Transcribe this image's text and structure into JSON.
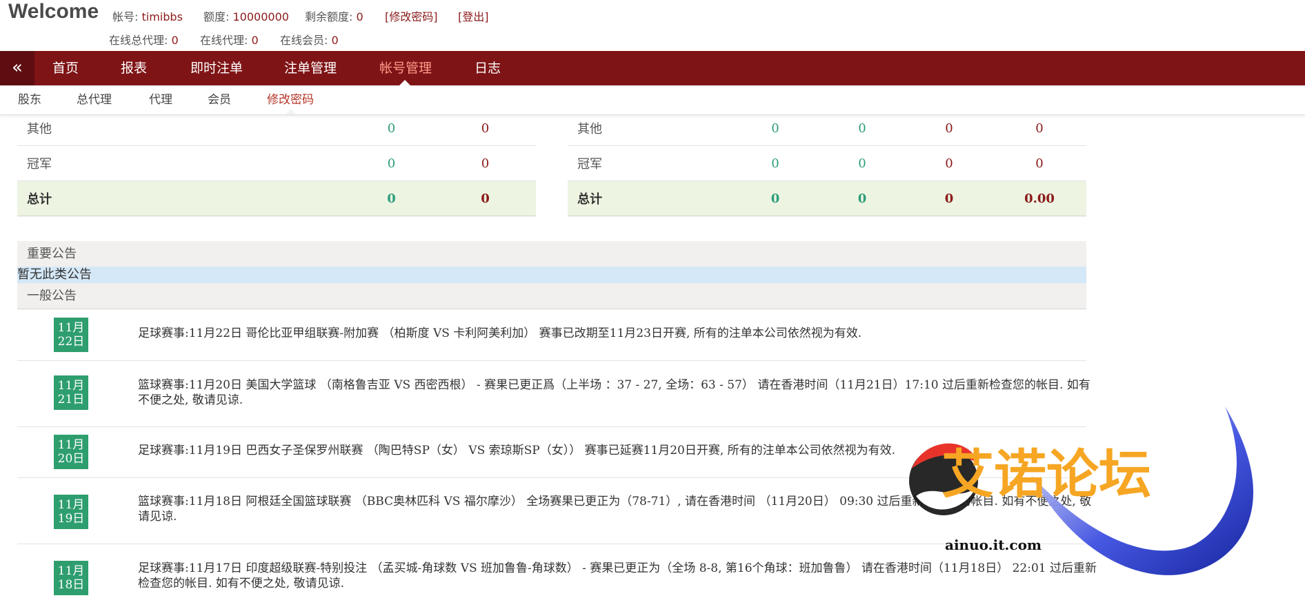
{
  "header": {
    "welcome": "Welcome",
    "account_label": "帐号:",
    "account_value": "timibbs",
    "credit_label": "额度:",
    "credit_value": "10000000",
    "remaining_label": "剩余额度:",
    "remaining_value": "0",
    "change_password": "[修改密码]",
    "logout": "[登出]",
    "online_gen_agents_label": "在线总代理:",
    "online_gen_agents_value": "0",
    "online_agents_label": "在线代理:",
    "online_agents_value": "0",
    "online_members_label": "在线会员:",
    "online_members_value": "0"
  },
  "nav": {
    "collapse_icon": "«",
    "items": [
      "首页",
      "报表",
      "即时注单",
      "注单管理",
      "帐号管理",
      "日志"
    ],
    "active": "帐号管理"
  },
  "subnav": {
    "items": [
      "股东",
      "总代理",
      "代理",
      "会员",
      "修改密码"
    ],
    "active": "修改密码"
  },
  "summary_left": [
    {
      "label": "其他",
      "a": "0",
      "b": "0"
    },
    {
      "label": "冠军",
      "a": "0",
      "b": "0"
    },
    {
      "label": "总计",
      "a": "0",
      "b": "0"
    }
  ],
  "summary_right": [
    {
      "label": "其他",
      "a": "0",
      "b": "0",
      "c": "0",
      "d": "0"
    },
    {
      "label": "冠军",
      "a": "0",
      "b": "0",
      "c": "0",
      "d": "0"
    },
    {
      "label": "总计",
      "a": "0",
      "b": "0",
      "c": "0",
      "d": "0.00"
    }
  ],
  "announcements": {
    "important_title": "重要公告",
    "important_empty": "暂无此类公告",
    "general_title": "一般公告",
    "items": [
      {
        "month": "11月",
        "day": "22日",
        "text": "足球赛事:11月22日 哥伦比亚甲组联赛-附加赛 （柏斯度 VS 卡利阿美利加） 赛事已改期至11月23日开赛, 所有的注单本公司依然视为有效."
      },
      {
        "month": "11月",
        "day": "21日",
        "text": "篮球赛事:11月20日 美国大学篮球 （南格鲁吉亚 VS 西密西根） - 赛果已更正爲（上半场 ：37 - 27, 全场：63 - 57） 请在香港时间（11月21日）17:10 过后重新检查您的帐目. 如有不便之处, 敬请见谅."
      },
      {
        "month": "11月",
        "day": "20日",
        "text": "足球赛事:11月19日 巴西女子圣保罗州联赛 （陶巴特SP（女） VS 索琼斯SP（女）） 赛事已延赛11月20日开赛, 所有的注单本公司依然视为有效."
      },
      {
        "month": "11月",
        "day": "19日",
        "text": "篮球赛事:11月18日 阿根廷全国篮球联赛 （BBC奥林匹科 VS 福尔摩沙） 全场赛果已更正为（78-71）, 请在香港时间 （11月20日） 09:30 过后重新检查您的帐目. 如有不便之处, 敬请见谅."
      },
      {
        "month": "11月",
        "day": "18日",
        "text": "足球赛事:11月17日 印度超级联赛-特别投注 （孟买城-角球数 VS 班加鲁鲁-角球数） - 赛果已更正为（全场 8-8, 第16个角球：班加鲁鲁） 请在香港时间（11月18日） 22:01 过后重新检查您的帐目. 如有不便之处, 敬请见谅."
      }
    ]
  },
  "watermark": {
    "title": "艾诺论坛",
    "domain": "ainuo.it.com"
  }
}
